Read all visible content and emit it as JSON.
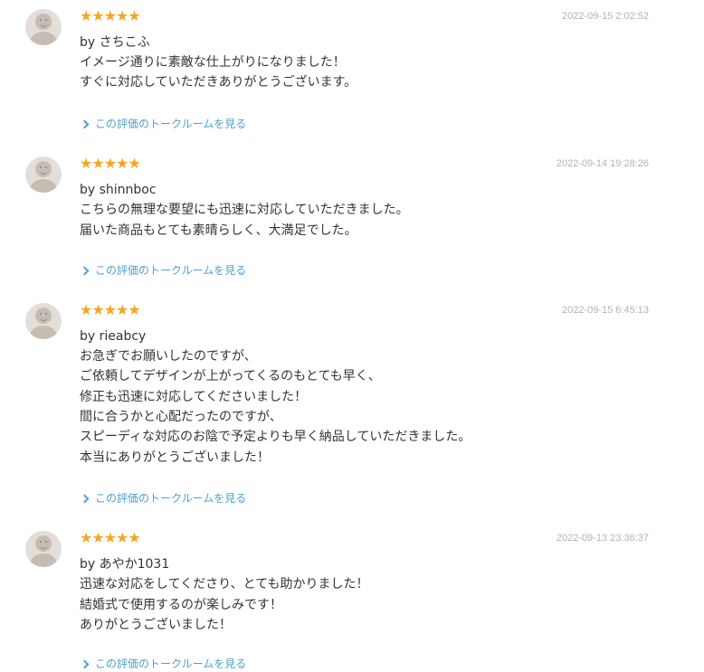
{
  "reviews": [
    {
      "stars": "★★★★★",
      "date": "2022-09-15 2:02:52",
      "author": "by さちこふ",
      "lines": [
        "イメージ通りに素敵な仕上がりになりました！",
        "すぐに対応していただきありがとうございます。"
      ],
      "link": "この評価のトークルームを見る"
    },
    {
      "stars": "★★★★★",
      "date": "2022-09-14 19:28:26",
      "author": "by shinnboc",
      "lines": [
        "こちらの無理な要望にも迅速に対応していただきました。",
        "届いた商品もとても素晴らしく、大満足でした。"
      ],
      "link": "この評価のトークルームを見る"
    },
    {
      "stars": "★★★★★",
      "date": "2022-09-15 6:45:13",
      "author": "by rieabcy",
      "lines": [
        "お急ぎでお願いしたのですが、",
        "ご依頼してデザインが上がってくるのもとても早く、",
        "修正も迅速に対応してくださいました！",
        "間に合うかと心配だったのですが、",
        "スピーディな対応のお陰で予定よりも早く納品していただきました。",
        "本当にありがとうございました！"
      ],
      "link": "この評価のトークルームを見る"
    },
    {
      "stars": "★★★★★",
      "date": "2022-09-13 23:36:37",
      "author": "by あやか1031",
      "lines": [
        "迅速な対応をしてくださり、とても助かりました！",
        "結婚式で使用するのが楽しみです！",
        "ありがとうございました！"
      ],
      "link": "この評価のトークルームを見る"
    }
  ]
}
